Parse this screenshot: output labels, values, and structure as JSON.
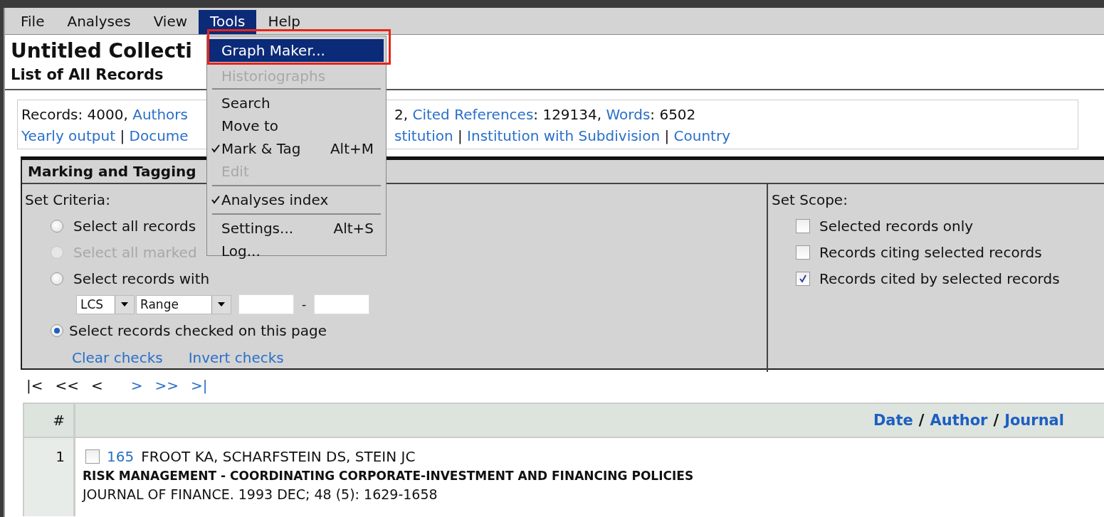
{
  "menubar": [
    {
      "label": "File",
      "selected": false
    },
    {
      "label": "Analyses",
      "selected": false
    },
    {
      "label": "View",
      "selected": false
    },
    {
      "label": "Tools",
      "selected": true
    },
    {
      "label": "Help",
      "selected": false
    }
  ],
  "header": {
    "title": "Untitled Collecti",
    "subtitle": "List of All Records"
  },
  "info": {
    "lines": [
      {
        "left": [
          {
            "kind": "text",
            "text": "Records: 4000, "
          },
          {
            "kind": "link",
            "text": "Authors"
          }
        ],
        "right": [
          {
            "kind": "text",
            "text": "2, "
          },
          {
            "kind": "link",
            "text": "Cited References"
          },
          {
            "kind": "text",
            "text": ": 129134, "
          },
          {
            "kind": "link",
            "text": "Words"
          },
          {
            "kind": "text",
            "text": ": 6502"
          }
        ]
      },
      {
        "left": [
          {
            "kind": "link",
            "text": "Yearly output"
          },
          {
            "kind": "text",
            "text": " | "
          },
          {
            "kind": "link",
            "text": "Docume"
          }
        ],
        "right": [
          {
            "kind": "link",
            "text": "stitution"
          },
          {
            "kind": "text",
            "text": " | "
          },
          {
            "kind": "link",
            "text": "Institution with Subdivision"
          },
          {
            "kind": "text",
            "text": " | "
          },
          {
            "kind": "link",
            "text": "Country"
          }
        ]
      }
    ]
  },
  "marking": {
    "title": "Marking and Tagging",
    "criteria": {
      "label": "Set Criteria:",
      "options": [
        {
          "kind": "radio",
          "label": "Select all records",
          "selected": false,
          "disabled": false
        },
        {
          "kind": "radio",
          "label": "Select all marked",
          "selected": false,
          "disabled": true
        },
        {
          "kind": "radio",
          "label": "Select records with",
          "selected": false,
          "disabled": false
        },
        {
          "kind": "filter",
          "field": "LCS",
          "mode": "Range",
          "separator": "-"
        },
        {
          "kind": "radio",
          "label": "Select records checked on this page",
          "selected": true,
          "disabled": false
        },
        {
          "kind": "links",
          "links": [
            "Clear checks",
            "Invert checks"
          ]
        }
      ]
    },
    "scope": {
      "label": "Set Scope:",
      "options": [
        {
          "label": "Selected records only",
          "checked": false
        },
        {
          "label": "Records citing selected records",
          "checked": false
        },
        {
          "label": "Records cited by selected records",
          "checked": true
        }
      ]
    }
  },
  "pager": [
    {
      "label": "|<",
      "enabled": false
    },
    {
      "label": "<<",
      "enabled": false
    },
    {
      "label": "<",
      "enabled": false
    },
    {
      "label": ">",
      "enabled": true
    },
    {
      "label": ">>",
      "enabled": true
    },
    {
      "label": ">|",
      "enabled": true
    }
  ],
  "table": {
    "number_heading": "#",
    "sort_links": [
      "Date",
      "Author",
      "Journal"
    ],
    "sort_separator": "/",
    "rows": [
      {
        "number": "1",
        "checked": false,
        "lcs": "165",
        "authors": "FROOT KA, SCHARFSTEIN DS, STEIN JC",
        "title": "RISK MANAGEMENT - COORDINATING CORPORATE-INVESTMENT AND FINANCING POLICIES",
        "source": "JOURNAL OF FINANCE. 1993 DEC; 48 (5): 1629-1658"
      }
    ]
  },
  "tools_menu": {
    "highlighted": true,
    "items": [
      {
        "kind": "item",
        "label": "Graph Maker...",
        "selected": true,
        "disabled": false,
        "checked": false
      },
      {
        "kind": "item",
        "label": "Historiographs",
        "selected": false,
        "disabled": true,
        "checked": false
      },
      {
        "kind": "separator"
      },
      {
        "kind": "item",
        "label": "Search",
        "selected": false,
        "disabled": false,
        "checked": false
      },
      {
        "kind": "item",
        "label": "Move to",
        "selected": false,
        "disabled": false,
        "checked": false
      },
      {
        "kind": "item",
        "label": "Mark & Tag",
        "shortcut": "Alt+M",
        "selected": false,
        "disabled": false,
        "checked": true
      },
      {
        "kind": "item",
        "label": "Edit",
        "selected": false,
        "disabled": true,
        "checked": false
      },
      {
        "kind": "separator"
      },
      {
        "kind": "item",
        "label": "Analyses index",
        "selected": false,
        "disabled": false,
        "checked": true
      },
      {
        "kind": "separator"
      },
      {
        "kind": "item",
        "label": "Settings...",
        "shortcut": "Alt+S",
        "selected": false,
        "disabled": false,
        "checked": false
      },
      {
        "kind": "item",
        "label": "Log...",
        "selected": false,
        "disabled": false,
        "checked": false
      }
    ]
  }
}
